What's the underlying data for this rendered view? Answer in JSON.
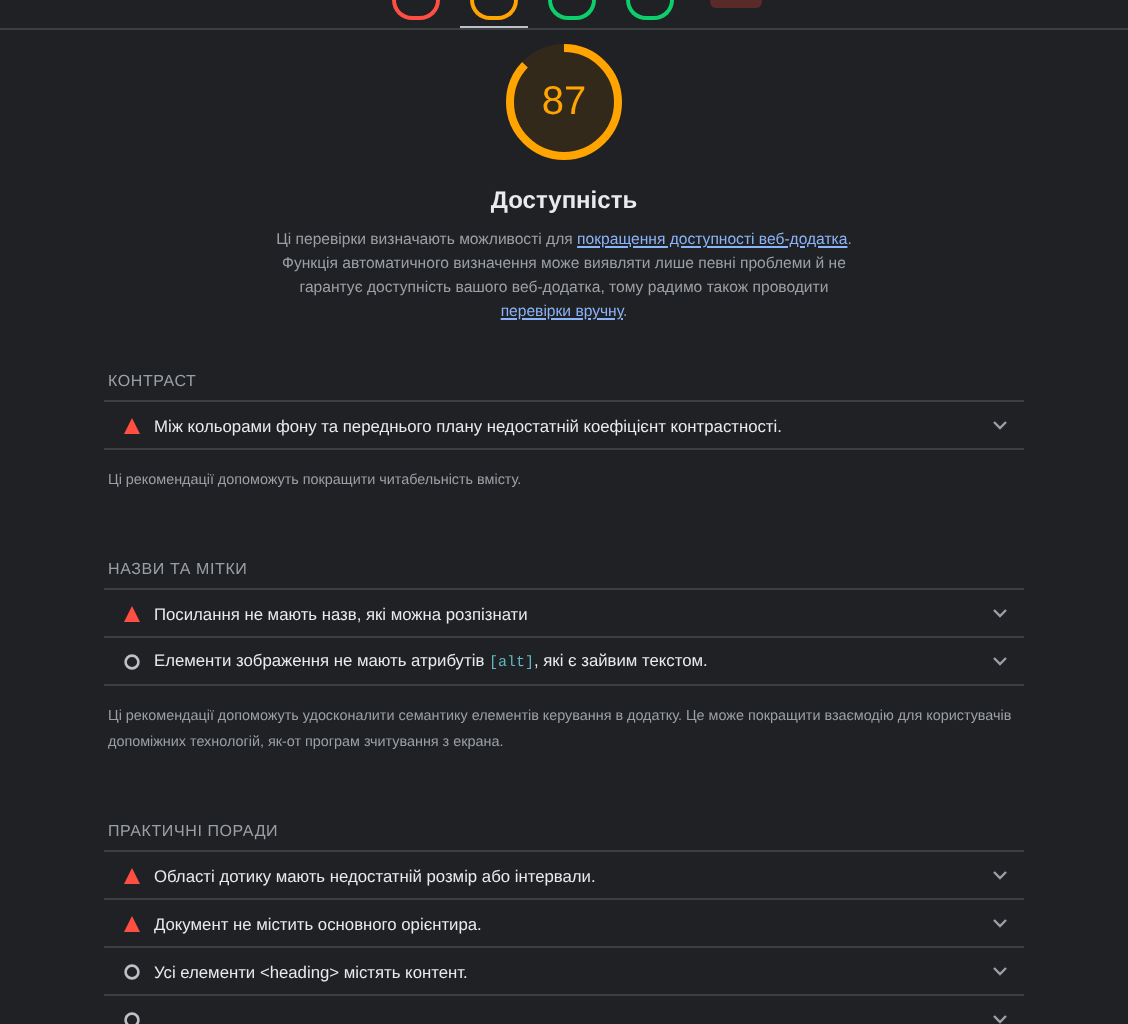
{
  "gauges": [
    {
      "kind": "gauge",
      "color": "#ff4e42",
      "selected": false
    },
    {
      "kind": "gauge",
      "color": "#ffa400",
      "selected": true
    },
    {
      "kind": "gauge",
      "color": "#0cce6b",
      "selected": false
    },
    {
      "kind": "gauge",
      "color": "#0cce6b",
      "selected": false
    },
    {
      "kind": "badge",
      "color": "#5a2a28",
      "selected": false
    }
  ],
  "category": {
    "score": "87",
    "title": "Доступність",
    "description": [
      {
        "kind": "text",
        "text": "Ці перевірки визначають можливості для "
      },
      {
        "kind": "link",
        "text": "покращення доступності веб-додатка"
      },
      {
        "kind": "text",
        "text": ". Функція автоматичного визначення може виявляти лише певні проблеми й не гарантує доступність вашого веб-додатка, тому радимо також проводити "
      },
      {
        "kind": "link",
        "text": "перевірки вручну"
      },
      {
        "kind": "text",
        "text": "."
      }
    ]
  },
  "groups": [
    {
      "title": "КОНТРАСТ",
      "audits": [
        {
          "kind": "fail",
          "label": [
            {
              "kind": "text",
              "text": "Між кольорами фону та переднього плану недостатній коефіцієнт контрастності."
            }
          ]
        }
      ],
      "description": "Ці рекомендації допоможуть покращити читабельність вмісту."
    },
    {
      "title": "НАЗВИ ТА МІТКИ",
      "audits": [
        {
          "kind": "fail",
          "label": [
            {
              "kind": "text",
              "text": "Посилання не мають назв, які можна розпізнати"
            }
          ]
        },
        {
          "kind": "info",
          "label": [
            {
              "kind": "text",
              "text": "Елементи зображення не мають атрибутів "
            },
            {
              "kind": "code",
              "text": "[alt]"
            },
            {
              "kind": "text",
              "text": ", які є зайвим текстом."
            }
          ]
        }
      ],
      "description": "Ці рекомендації допоможуть удосконалити семантику елементів керування в додатку. Це може покращити взаємодію для користувачів допоміжних технологій, як-от програм зчитування з екрана."
    },
    {
      "title": "ПРАКТИЧНІ ПОРАДИ",
      "audits": [
        {
          "kind": "fail",
          "label": [
            {
              "kind": "text",
              "text": "Області дотику мають недостатній розмір або інтервали."
            }
          ]
        },
        {
          "kind": "fail",
          "label": [
            {
              "kind": "text",
              "text": "Документ не містить основного орієнтира."
            }
          ]
        },
        {
          "kind": "info",
          "label": [
            {
              "kind": "text",
              "text": "Усі елементи <heading> містять контент."
            }
          ]
        },
        {
          "kind": "info"
        }
      ]
    }
  ]
}
